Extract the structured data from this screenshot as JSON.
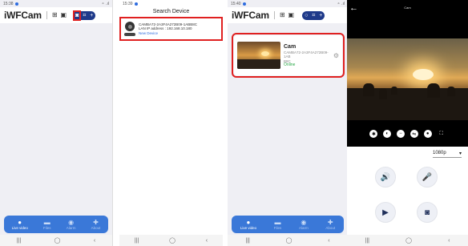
{
  "phone1": {
    "status": {
      "time": "15:38",
      "right": "⚬ .ıl"
    },
    "brand": "iWFCam",
    "tabs": [
      {
        "label": "Live video",
        "icon": "play-icon"
      },
      {
        "label": "Files",
        "icon": "folder-icon"
      },
      {
        "label": "Alarm",
        "icon": "bell-icon"
      },
      {
        "label": "About",
        "icon": "puzzle-icon"
      }
    ]
  },
  "phone2": {
    "status": {
      "time": "15:39",
      "right": ""
    },
    "title": "Search Device",
    "device": {
      "id": "CAMBA72-2A3F4A272B09-1ABB8C",
      "ip": "LAN IP address : 192.168.10.180",
      "state": "New Device"
    }
  },
  "phone3": {
    "status": {
      "time": "15:40",
      "right": "⚬ .ıl"
    },
    "brand": "iWFCam",
    "camera": {
      "name": "Cam",
      "id": "CAMBA72-2A3F4A272B09-1AB",
      "id2": "B8C",
      "status": "Online"
    },
    "tabs": [
      {
        "label": "Live video",
        "icon": "play-icon"
      },
      {
        "label": "Files",
        "icon": "folder-icon"
      },
      {
        "label": "Alarm",
        "icon": "bell-icon"
      },
      {
        "label": "About",
        "icon": "puzzle-icon"
      }
    ]
  },
  "phone4": {
    "title": "Cam",
    "quality": "1080p"
  },
  "navbar": {
    "recent": "|||",
    "home": "◯",
    "back": "‹"
  },
  "colors": {
    "accent": "#3a78d8",
    "pill": "#1f3a8a",
    "highlight": "#e02020",
    "online": "#27a745"
  }
}
